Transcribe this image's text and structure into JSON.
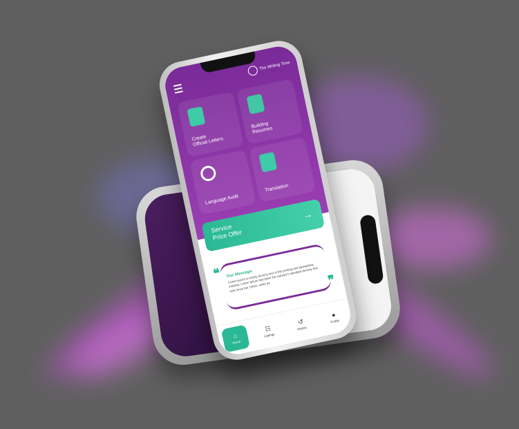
{
  "app": {
    "brand_name": "The Writing Time"
  },
  "services": [
    {
      "label": "Create\nOfficial Letters",
      "icon": "document-pen-icon"
    },
    {
      "label": "Building\nResumes",
      "icon": "resume-icon"
    },
    {
      "label": "Language Audit",
      "icon": "magnifier-document-icon"
    },
    {
      "label": "Translation",
      "icon": "translation-icon"
    }
  ],
  "cta": {
    "label": "Service\nPrice Offer",
    "arrow": "→"
  },
  "message": {
    "title": "Our Message",
    "body": "Lorem Ipsum is simply dummy text of the printing and typesetting industry. Lorem Ipsum has been the industry's standard dummy text ever since the 1500s, when an"
  },
  "nav": [
    {
      "label": "Home",
      "glyph": "⌂",
      "active": true
    },
    {
      "label": "Listings",
      "glyph": "☷",
      "active": false
    },
    {
      "label": "History",
      "glyph": "↺",
      "active": false
    },
    {
      "label": "Profile",
      "glyph": "●",
      "active": false
    }
  ],
  "colors": {
    "background": "#5f5f5f",
    "purple": "#7a2a98",
    "accent": "#2bb894"
  }
}
